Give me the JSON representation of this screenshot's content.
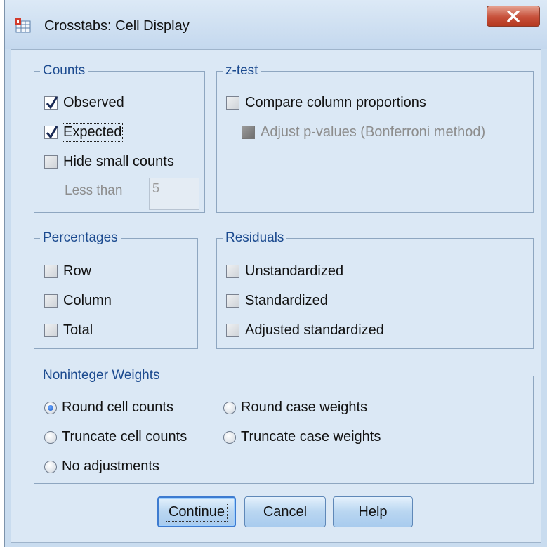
{
  "window": {
    "title": "Crosstabs: Cell Display",
    "close_glyph": "X"
  },
  "counts": {
    "legend": "Counts",
    "observed": {
      "label": "Observed",
      "checked": true
    },
    "expected": {
      "label": "Expected",
      "checked": true
    },
    "hide_small": {
      "label": "Hide small counts",
      "checked": false
    },
    "less_than_label": "Less than",
    "less_than_value": "5"
  },
  "ztest": {
    "legend": "z-test",
    "compare": {
      "label": "Compare column proportions",
      "checked": false
    },
    "adjust": {
      "label": "Adjust p-values (Bonferroni method)",
      "checked": false,
      "enabled": false
    }
  },
  "percentages": {
    "legend": "Percentages",
    "items": [
      {
        "label": "Row",
        "checked": false
      },
      {
        "label": "Column",
        "checked": false
      },
      {
        "label": "Total",
        "checked": false
      }
    ]
  },
  "residuals": {
    "legend": "Residuals",
    "items": [
      {
        "label": "Unstandardized",
        "checked": false
      },
      {
        "label": "Standardized",
        "checked": false
      },
      {
        "label": "Adjusted standardized",
        "checked": false
      }
    ]
  },
  "noninteger": {
    "legend": "Noninteger Weights",
    "options": [
      {
        "label": "Round cell counts",
        "selected": true
      },
      {
        "label": "Round case weights",
        "selected": false
      },
      {
        "label": "Truncate cell counts",
        "selected": false
      },
      {
        "label": "Truncate case weights",
        "selected": false
      },
      {
        "label": "No adjustments",
        "selected": false
      }
    ]
  },
  "buttons": {
    "continue": "Continue",
    "cancel": "Cancel",
    "help": "Help"
  },
  "colors": {
    "window_frame": "#c9dcef",
    "client_bg": "#dbe8f5",
    "legend_text": "#1b4a8f",
    "close_button": "#c7503a",
    "button_face": "#b9d6f1"
  }
}
